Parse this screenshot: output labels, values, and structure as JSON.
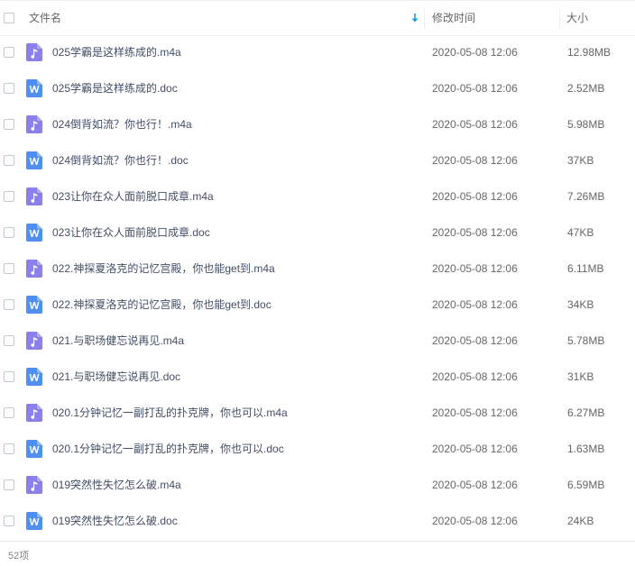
{
  "header": {
    "name_label": "文件名",
    "time_label": "修改时间",
    "size_label": "大小",
    "sort_icon": "sort-down-arrow-icon"
  },
  "colors": {
    "audio_icon": "#8b7fe8",
    "doc_icon": "#4e8ff0",
    "sort_arrow": "#1e9be6"
  },
  "files": [
    {
      "type": "audio",
      "icon": "music-note-icon",
      "name": "025学霸是这样练成的.m4a",
      "modified": "2020-05-08 12:06",
      "size": "12.98MB"
    },
    {
      "type": "doc",
      "icon": "word-doc-icon",
      "name": "025学霸是这样练成的.doc",
      "modified": "2020-05-08 12:06",
      "size": "2.52MB"
    },
    {
      "type": "audio",
      "icon": "music-note-icon",
      "name": "024倒背如流？你也行！.m4a",
      "modified": "2020-05-08 12:06",
      "size": "5.98MB"
    },
    {
      "type": "doc",
      "icon": "word-doc-icon",
      "name": "024倒背如流？你也行！.doc",
      "modified": "2020-05-08 12:06",
      "size": "37KB"
    },
    {
      "type": "audio",
      "icon": "music-note-icon",
      "name": "023让你在众人面前脱口成章.m4a",
      "modified": "2020-05-08 12:06",
      "size": "7.26MB"
    },
    {
      "type": "doc",
      "icon": "word-doc-icon",
      "name": "023让你在众人面前脱口成章.doc",
      "modified": "2020-05-08 12:06",
      "size": "47KB"
    },
    {
      "type": "audio",
      "icon": "music-note-icon",
      "name": "022.神探夏洛克的记忆宫殿，你也能get到.m4a",
      "modified": "2020-05-08 12:06",
      "size": "6.11MB"
    },
    {
      "type": "doc",
      "icon": "word-doc-icon",
      "name": "022.神探夏洛克的记忆宫殿，你也能get到.doc",
      "modified": "2020-05-08 12:06",
      "size": "34KB"
    },
    {
      "type": "audio",
      "icon": "music-note-icon",
      "name": "021.与职场健忘说再见.m4a",
      "modified": "2020-05-08 12:06",
      "size": "5.78MB"
    },
    {
      "type": "doc",
      "icon": "word-doc-icon",
      "name": "021.与职场健忘说再见.doc",
      "modified": "2020-05-08 12:06",
      "size": "31KB"
    },
    {
      "type": "audio",
      "icon": "music-note-icon",
      "name": "020.1分钟记忆一副打乱的扑克牌，你也可以.m4a",
      "modified": "2020-05-08 12:06",
      "size": "6.27MB"
    },
    {
      "type": "doc",
      "icon": "word-doc-icon",
      "name": "020.1分钟记忆一副打乱的扑克牌，你也可以.doc",
      "modified": "2020-05-08 12:06",
      "size": "1.63MB"
    },
    {
      "type": "audio",
      "icon": "music-note-icon",
      "name": "019突然性失忆怎么破.m4a",
      "modified": "2020-05-08 12:06",
      "size": "6.59MB"
    },
    {
      "type": "doc",
      "icon": "word-doc-icon",
      "name": "019突然性失忆怎么破.doc",
      "modified": "2020-05-08 12:06",
      "size": "24KB"
    }
  ],
  "footer": {
    "count": "52项"
  }
}
